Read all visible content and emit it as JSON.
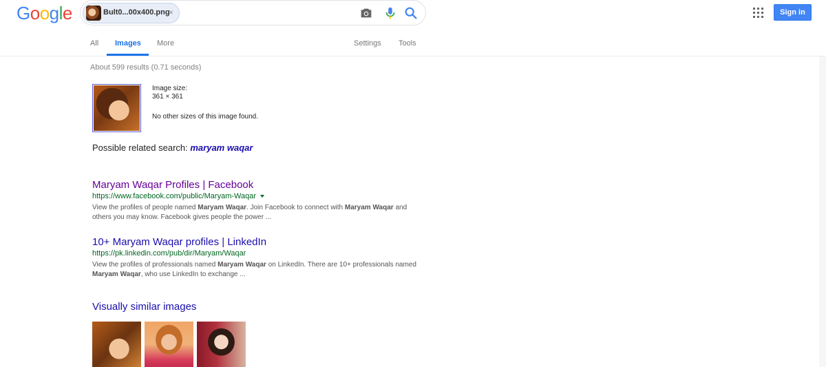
{
  "header": {
    "logo_letters": [
      "G",
      "o",
      "o",
      "g",
      "l",
      "e"
    ],
    "search_chip": {
      "label": "Bult0...00x400.png",
      "close": "×"
    },
    "camera_icon": "camera-icon",
    "mic_icon": "mic-icon",
    "search_icon": "search-icon",
    "apps_icon": "apps-grid-icon",
    "sign_in": "Sign in"
  },
  "tabs": {
    "all": "All",
    "images": "Images",
    "more": "More",
    "settings": "Settings",
    "tools": "Tools"
  },
  "main": {
    "results_stats": "About 599 results (0.71 seconds)",
    "image_info": {
      "size_label": "Image size:",
      "size_value": "361 × 361",
      "no_other_sizes": "No other sizes of this image found."
    },
    "related_search": {
      "label": "Possible related search:",
      "query": "maryam waqar"
    },
    "results": [
      {
        "title": "Maryam Waqar Profiles | Facebook",
        "url": "https://www.facebook.com/public/Maryam-Waqar",
        "snippet_parts": [
          "View the profiles of people named ",
          "Maryam Waqar",
          ". Join Facebook to connect with ",
          "Maryam Waqar",
          " and others you may know. Facebook gives people the power ..."
        ]
      },
      {
        "title": "10+ Maryam Waqar profiles | LinkedIn",
        "url": "https://pk.linkedin.com/pub/dir/Maryam/Waqar",
        "snippet_parts": [
          "View the profiles of professionals named ",
          "Maryam Waqar",
          " on LinkedIn. There are 10+ professionals named ",
          "Maryam Waqar",
          ", who use LinkedIn to exchange ..."
        ]
      }
    ],
    "similar_title": "Visually similar images"
  },
  "colors": {
    "link_visited": "#660099",
    "link": "#1a0dab",
    "url_green": "#006621",
    "accent_blue": "#1a73e8",
    "signin_blue": "#4285f4"
  }
}
